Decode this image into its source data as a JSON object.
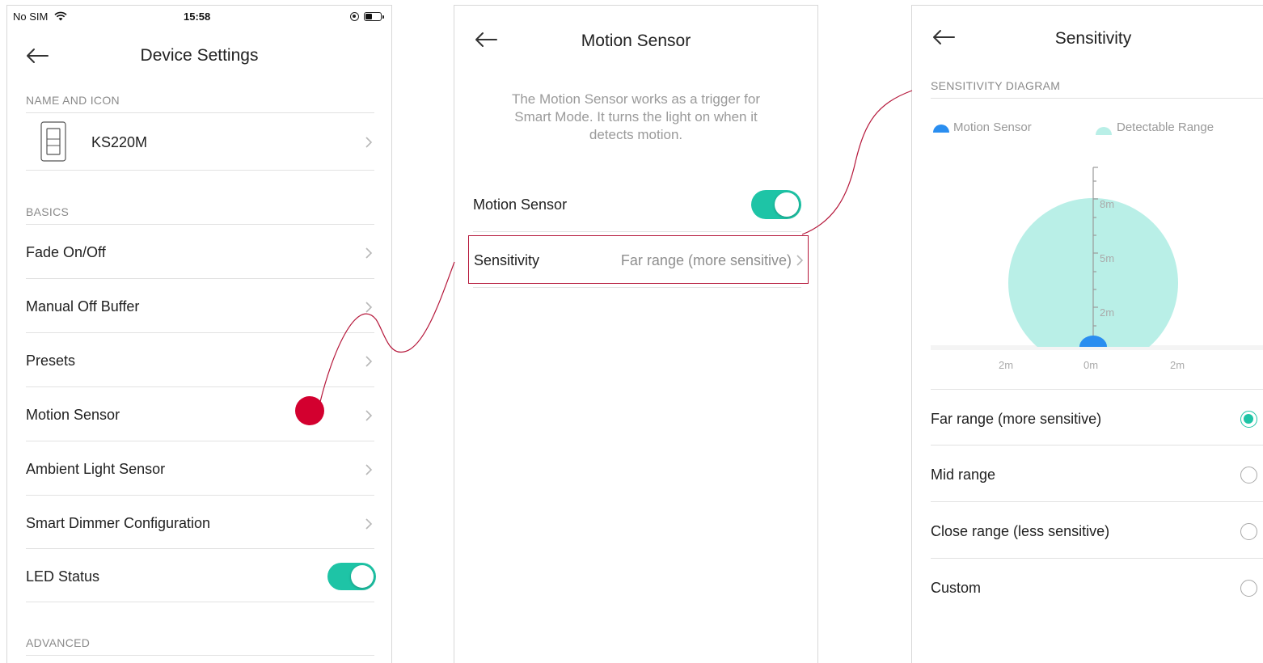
{
  "status_bar": {
    "carrier": "No SIM",
    "time": "15:58"
  },
  "device_settings": {
    "title": "Device Settings",
    "sections": {
      "name_and_icon": "NAME AND ICON",
      "basics": "BASICS",
      "advanced": "ADVANCED"
    },
    "device_name": "KS220M",
    "items": [
      {
        "label": "Fade On/Off"
      },
      {
        "label": "Manual Off Buffer"
      },
      {
        "label": "Presets"
      },
      {
        "label": "Motion Sensor"
      },
      {
        "label": "Ambient Light Sensor"
      },
      {
        "label": "Smart Dimmer Configuration"
      }
    ],
    "led_status": {
      "label": "LED Status",
      "enabled": true
    }
  },
  "motion_sensor": {
    "title": "Motion Sensor",
    "description_line1": "The Motion Sensor works as a trigger for",
    "description_line2": "Smart Mode. It turns the light on when it",
    "description_line3": "detects motion.",
    "toggle": {
      "label": "Motion Sensor",
      "enabled": true
    },
    "sensitivity": {
      "label": "Sensitivity",
      "value": "Far range (more sensitive)"
    }
  },
  "sensitivity": {
    "title": "Sensitivity",
    "diagram_header": "SENSITIVITY DIAGRAM",
    "legend": {
      "sensor": "Motion Sensor",
      "range": "Detectable Range"
    },
    "scale_labels": {
      "v8": "8m",
      "v5": "5m",
      "v2": "2m"
    },
    "axis_labels": {
      "left": "2m",
      "center": "0m",
      "right": "2m"
    },
    "options": [
      {
        "label": "Far range (more sensitive)",
        "selected": true
      },
      {
        "label": "Mid range",
        "selected": false
      },
      {
        "label": "Close range (less sensitive)",
        "selected": false
      },
      {
        "label": "Custom",
        "selected": false
      }
    ]
  },
  "colors": {
    "accent": "#1ec4a6",
    "highlight_border": "#b5173a",
    "tap_marker": "#d3002f",
    "range_fill": "#b9efe7",
    "sensor_blue": "#2a8ef0"
  }
}
